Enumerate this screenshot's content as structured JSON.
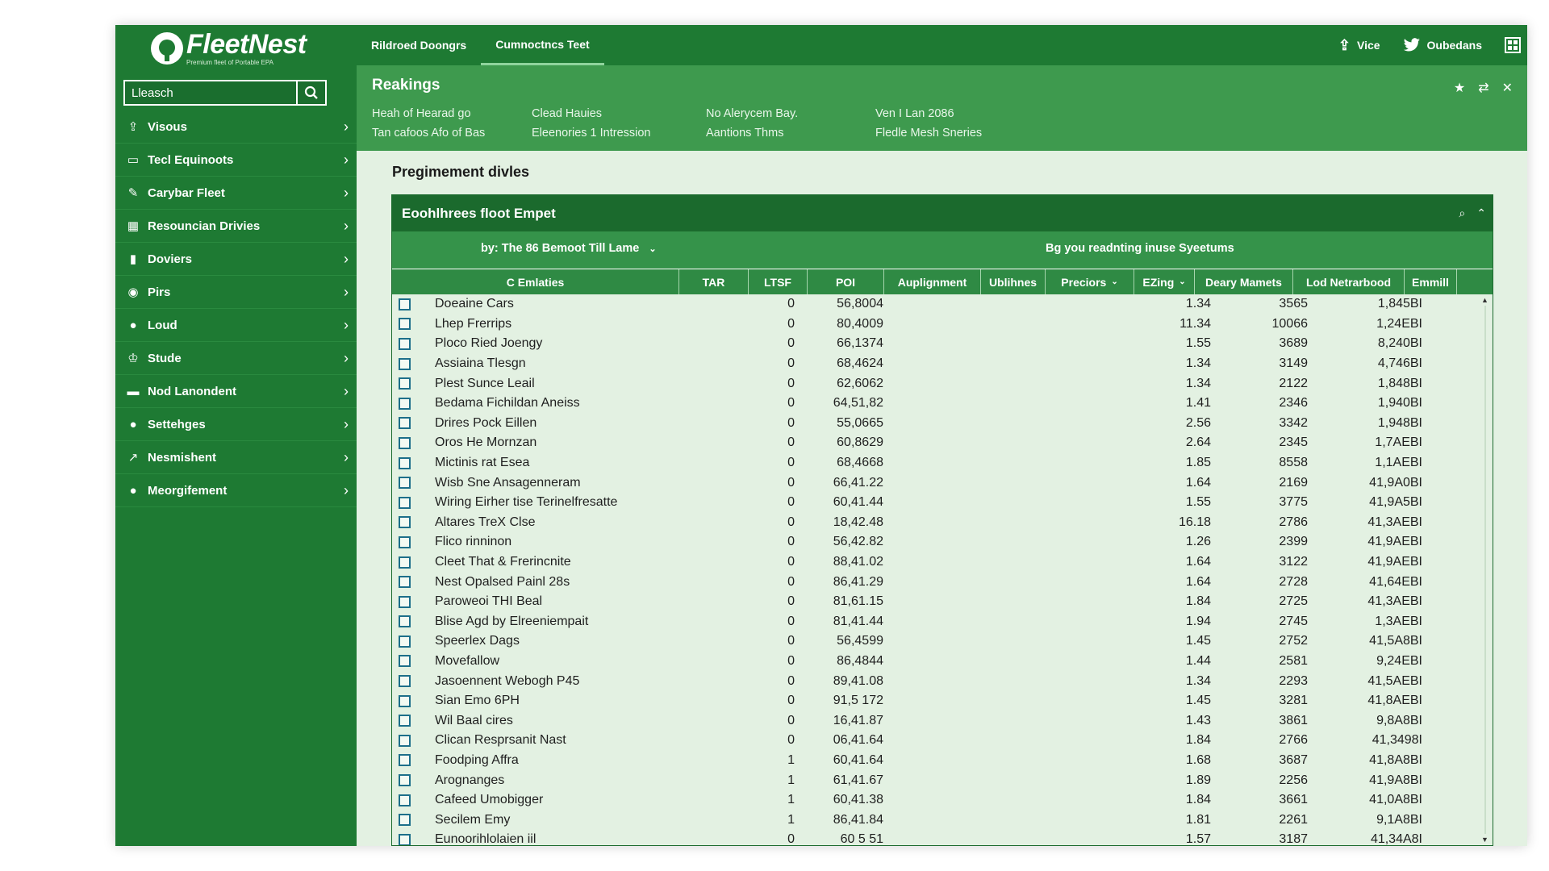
{
  "app": {
    "logo": "FleetNest",
    "tagline": "Premium fleet of Portable EPA"
  },
  "search": {
    "value": "Lleasch"
  },
  "sidebar": {
    "items": [
      {
        "label": "Visous",
        "icon": "upload-icon"
      },
      {
        "label": "Tecl Equinoots",
        "icon": "monitor-icon"
      },
      {
        "label": "Carybar Fleet",
        "icon": "pen-icon"
      },
      {
        "label": "Resouncian Drivies",
        "icon": "building-icon"
      },
      {
        "label": "Doviers",
        "icon": "bar-chart-icon"
      },
      {
        "label": "Pirs",
        "icon": "car-icon"
      },
      {
        "label": "Loud",
        "icon": "user-icon"
      },
      {
        "label": "Stude",
        "icon": "trophy-icon"
      },
      {
        "label": "Nod Lanondent",
        "icon": "truck-icon"
      },
      {
        "label": "Settehges",
        "icon": "user-icon"
      },
      {
        "label": "Nesmishent",
        "icon": "chart-line-icon"
      },
      {
        "label": "Meorgifement",
        "icon": "users-icon"
      }
    ]
  },
  "topbar": {
    "tabs": [
      {
        "label": "Rildroed Doongrs"
      },
      {
        "label": "Cumnoctncs Teet"
      }
    ],
    "actions": [
      {
        "label": "Vice",
        "icon": "upload-icon"
      },
      {
        "label": "Oubedans",
        "icon": "twitter-icon"
      }
    ]
  },
  "header": {
    "title": "Reakings",
    "stats": [
      [
        "Heah of Hearad go",
        "Tan cafoos Afo of Bas"
      ],
      [
        "Clead Hauies",
        "Eleenories 1 Intression"
      ],
      [
        "No Alerycem Bay.",
        "Aantions Thms"
      ],
      [
        "Ven I Lan 2086",
        "Fledle Mesh Sneries"
      ]
    ]
  },
  "section": {
    "title": "Pregimement divles"
  },
  "card": {
    "title": "Eoohlhrees floot Empet",
    "filter_left": "by: The 86 Bemoot Till Lame",
    "filter_right": "Bg you readnting inuse Syeetums"
  },
  "columns": [
    "C Emlaties",
    "TAR",
    "LTSF",
    "POI",
    "Auplignment",
    "Ublihnes",
    "Preciors",
    "EZing",
    "Deary Mamets",
    "Lod Netrarbood",
    "Emmill"
  ],
  "rows": [
    {
      "name": "Doeaine Cars",
      "ltsf": "0",
      "poi": "56,8004",
      "zf": "1.34",
      "mar": "3565",
      "net": "1,845BI"
    },
    {
      "name": "Lhep Frerrips",
      "ltsf": "0",
      "poi": "80,4009",
      "zf": "11.34",
      "mar": "10066",
      "net": "1,24EBI"
    },
    {
      "name": "Ploco Ried Joengy",
      "ltsf": "0",
      "poi": "66,1374",
      "zf": "1.55",
      "mar": "3689",
      "net": "8,240BI"
    },
    {
      "name": "Assiaina Tlesgn",
      "ltsf": "0",
      "poi": "68,4624",
      "zf": "1.34",
      "mar": "3149",
      "net": "4,746BI"
    },
    {
      "name": "Plest Sunce Leail",
      "ltsf": "0",
      "poi": "62,6062",
      "zf": "1.34",
      "mar": "2122",
      "net": "1,848BI"
    },
    {
      "name": "Bedama Fichildan Aneiss",
      "ltsf": "0",
      "poi": "64,51,82",
      "zf": "1.41",
      "mar": "2346",
      "net": "1,940BI"
    },
    {
      "name": "Drires Pock Eillen",
      "ltsf": "0",
      "poi": "55,0665",
      "zf": "2.56",
      "mar": "3342",
      "net": "1,948BI"
    },
    {
      "name": "Oros He Mornzan",
      "ltsf": "0",
      "poi": "60,8629",
      "zf": "2.64",
      "mar": "2345",
      "net": "1,7AEBI"
    },
    {
      "name": "Mictinis rat Esea",
      "ltsf": "0",
      "poi": "68,4668",
      "zf": "1.85",
      "mar": "8558",
      "net": "1,1AEBI"
    },
    {
      "name": "Wisb Sne Ansagenneram",
      "ltsf": "0",
      "poi": "66,41.22",
      "zf": "1.64",
      "mar": "2169",
      "net": "41,9A0BI"
    },
    {
      "name": "Wiring Eirher tise Terinelfresatte",
      "ltsf": "0",
      "poi": "60,41.44",
      "zf": "1.55",
      "mar": "3775",
      "net": "41,9A5BI"
    },
    {
      "name": "Altares TreX Clse",
      "ltsf": "0",
      "poi": "18,42.48",
      "zf": "16.18",
      "mar": "2786",
      "net": "41,3AEBI"
    },
    {
      "name": "Flico rinninon",
      "ltsf": "0",
      "poi": "56,42.82",
      "zf": "1.26",
      "mar": "2399",
      "net": "41,9AEBI"
    },
    {
      "name": "Cleet That & Frerincnite",
      "ltsf": "0",
      "poi": "88,41.02",
      "zf": "1.64",
      "mar": "3122",
      "net": "41,9AEBI"
    },
    {
      "name": "Nest Opalsed Painl 28s",
      "ltsf": "0",
      "poi": "86,41.29",
      "zf": "1.64",
      "mar": "2728",
      "net": "41,64EBI"
    },
    {
      "name": "Paroweoi THI Beal",
      "ltsf": "0",
      "poi": "81,61.15",
      "zf": "1.84",
      "mar": "2725",
      "net": "41,3AEBI"
    },
    {
      "name": "Blise Agd by Elreeniempait",
      "ltsf": "0",
      "poi": "81,41.44",
      "zf": "1.94",
      "mar": "2745",
      "net": "1,3AEBI"
    },
    {
      "name": "Speerlex Dags",
      "ltsf": "0",
      "poi": "56,4599",
      "zf": "1.45",
      "mar": "2752",
      "net": "41,5A8BI"
    },
    {
      "name": "Movefallow",
      "ltsf": "0",
      "poi": "86,4844",
      "zf": "1.44",
      "mar": "2581",
      "net": "9,24EBI"
    },
    {
      "name": "Jasoennent Webogh P45",
      "ltsf": "0",
      "poi": "89,41.08",
      "zf": "1.34",
      "mar": "2293",
      "net": "41,5AEBI"
    },
    {
      "name": "Sian Emo 6PH",
      "ltsf": "0",
      "poi": "91,5 172",
      "zf": "1.45",
      "mar": "3281",
      "net": "41,8AEBI"
    },
    {
      "name": "Wil Baal cires",
      "ltsf": "0",
      "poi": "16,41.87",
      "zf": "1.43",
      "mar": "3861",
      "net": "9,8A8BI"
    },
    {
      "name": "Clican Resprsanit Nast",
      "ltsf": "0",
      "poi": "06,41.64",
      "zf": "1.84",
      "mar": "2766",
      "net": "41,3498I"
    },
    {
      "name": "Foodping Affra",
      "ltsf": "1",
      "poi": "60,41.64",
      "zf": "1.68",
      "mar": "3687",
      "net": "41,8A8BI"
    },
    {
      "name": "Arognanges",
      "ltsf": "1",
      "poi": "61,41.67",
      "zf": "1.89",
      "mar": "2256",
      "net": "41,9A8BI"
    },
    {
      "name": "Cafeed Umobigger",
      "ltsf": "1",
      "poi": "60,41.38",
      "zf": "1.84",
      "mar": "3661",
      "net": "41,0A8BI"
    },
    {
      "name": "Secilem Emy",
      "ltsf": "1",
      "poi": "86,41.84",
      "zf": "1.81",
      "mar": "2261",
      "net": "9,1A8BI"
    },
    {
      "name": "Eunoorihlolaien iil",
      "ltsf": "0",
      "poi": "60 5 51",
      "zf": "1.57",
      "mar": "3187",
      "net": "41,34A8I"
    }
  ]
}
